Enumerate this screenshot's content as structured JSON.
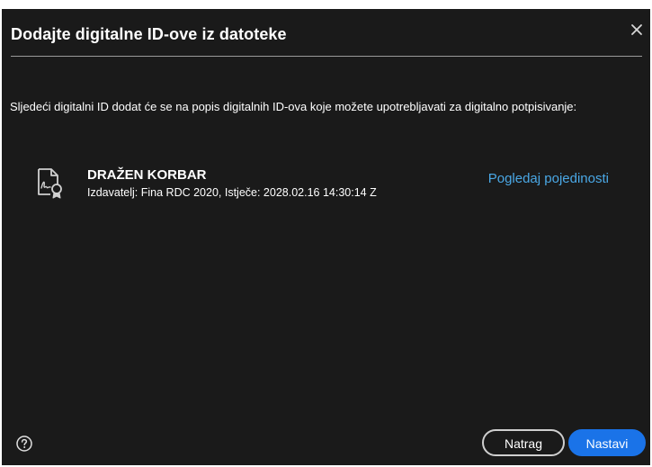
{
  "dialog": {
    "title": "Dodajte digitalne ID-ove iz datoteke",
    "description": "Sljedeći digitalni ID dodat će se na popis digitalnih ID-ova koje možete upotrebljavati za digitalno potpisivanje:",
    "certificate": {
      "name": "DRAŽEN KORBAR",
      "issuer_line": "Izdavatelj: Fina RDC 2020, Istječe: 2028.02.16 14:30:14 Z",
      "icon": "certificate-icon"
    },
    "details_link": "Pogledaj pojedinosti",
    "buttons": {
      "back_label": "Natrag",
      "next_label": "Nastavi"
    },
    "icons": {
      "close": "close-icon",
      "help": "help-icon"
    }
  },
  "colors": {
    "background": "#1a1a1a",
    "accent": "#1a73e8",
    "link": "#4aa8e6",
    "text": "#ffffff"
  }
}
